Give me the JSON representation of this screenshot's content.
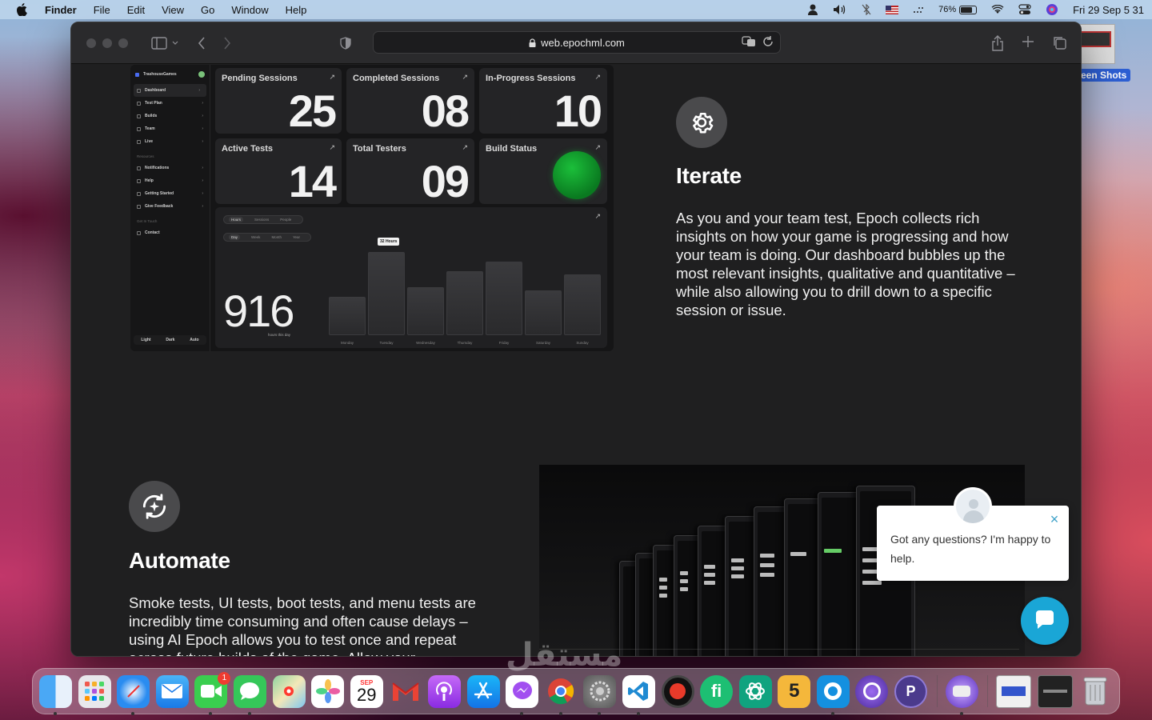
{
  "menubar": {
    "app_name": "Finder",
    "menus": [
      "File",
      "Edit",
      "View",
      "Go",
      "Window",
      "Help"
    ],
    "battery": "76%",
    "datetime": "Fri 29 Sep  5 31"
  },
  "desktop": {
    "screenshot_label": "een Shots"
  },
  "browser": {
    "url": "web.epochml.com"
  },
  "dashboard": {
    "brand": "TrashouseGames",
    "nav": [
      "Dashboard",
      "Test Plan",
      "Builds",
      "Team",
      "Live"
    ],
    "resources_label": "Resources",
    "resources": [
      "Notifications",
      "Help",
      "Getting Started",
      "Give Feedback"
    ],
    "get_in_touch_label": "Get In Touch",
    "contact": "Contact",
    "theme": [
      "Light",
      "Dark",
      "Auto"
    ],
    "cards": [
      {
        "title": "Pending Sessions",
        "value": "25"
      },
      {
        "title": "Completed Sessions",
        "value": "08"
      },
      {
        "title": "In-Progress Sessions",
        "value": "10"
      },
      {
        "title": "Active Tests",
        "value": "14"
      },
      {
        "title": "Total Testers",
        "value": "09"
      },
      {
        "title": "Build Status",
        "value": ""
      }
    ],
    "toggle1": [
      "Hours",
      "Sessions",
      "People"
    ],
    "toggle2": [
      "Day",
      "Week",
      "Month",
      "Year"
    ],
    "total": "916",
    "total_sub": "hours this day",
    "tooltip": "32 Hours",
    "chart_data": {
      "type": "bar",
      "categories": [
        "Monday",
        "Tuesday",
        "Wednesday",
        "Thursday",
        "Friday",
        "Saturday",
        "Sunday"
      ],
      "values": [
        12,
        26,
        15,
        20,
        23,
        14,
        19
      ],
      "title": "",
      "xlabel": "",
      "ylabel": "",
      "ylim": [
        0,
        32
      ]
    }
  },
  "sections": {
    "iterate": {
      "title": "Iterate",
      "body": "As you and your team test, Epoch collects rich insights on how your game is progressing and how your team is doing. Our dashboard bubbles up the most relevant insights, qualitative and quantitative – while also allowing you to drill down to a specific session or issue."
    },
    "automate": {
      "title": "Automate",
      "body": "Smoke tests, UI tests, boot tests, and menu tests are incredibly time consuming and often cause delays – using AI Epoch allows you to test once and repeat across future builds of the game. Allow your"
    }
  },
  "chat": {
    "message": "Got any questions? I'm happy to help."
  },
  "dock": {
    "apps": [
      "finder",
      "launchpad",
      "safari",
      "mail",
      "facetime",
      "messages",
      "maps",
      "photos",
      "calendar",
      "gmail",
      "podcasts",
      "app-store",
      "messenger",
      "chrome",
      "system-settings",
      "vscode",
      "recorder",
      "fiverr",
      "chatgpt",
      "5",
      "screen-app",
      "lasso",
      "app-p"
    ],
    "facetime_badge": "1",
    "calendar_month": "SEP",
    "calendar_day": "29",
    "fiverr_label": "fi",
    "five_label": "5",
    "p_label": "P"
  },
  "watermark": "مستقل"
}
